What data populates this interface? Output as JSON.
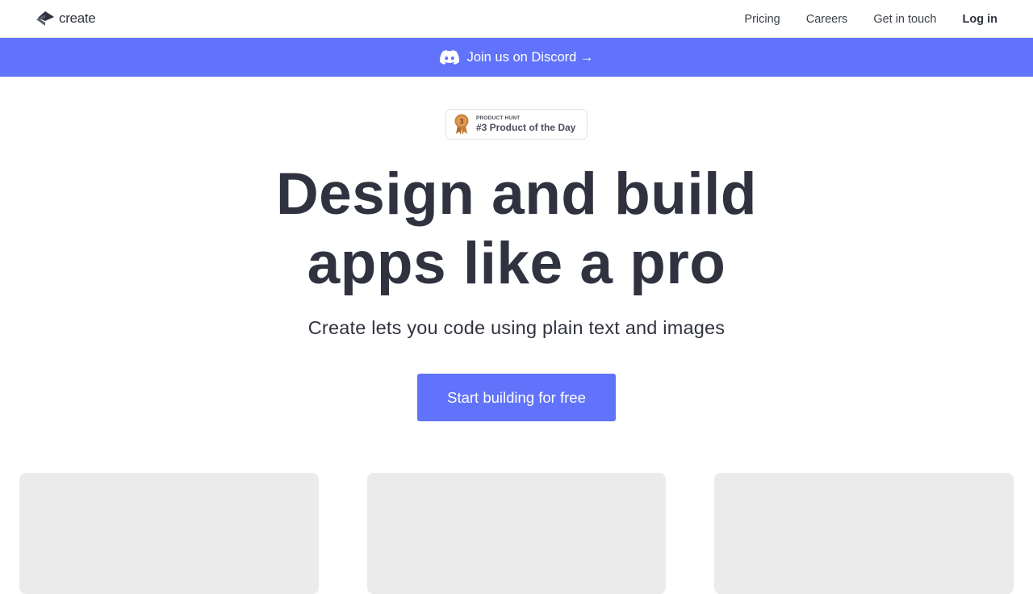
{
  "nav": {
    "brand": "create",
    "links": [
      {
        "label": "Pricing"
      },
      {
        "label": "Careers"
      },
      {
        "label": "Get in touch"
      }
    ],
    "login": "Log in"
  },
  "banner": {
    "text": "Join us on Discord →",
    "icon": "discord-icon",
    "color": "#6173fa"
  },
  "badge": {
    "kicker": "PRODUCT HUNT",
    "title": "#3 Product of the Day",
    "medal_number": "3"
  },
  "hero": {
    "title_line1": "Design and build",
    "title_line2": "apps like a pro",
    "subtitle": "Create lets you code using plain text and images",
    "cta": "Start building for free"
  },
  "colors": {
    "accent": "#6173fa",
    "text": "#30333f",
    "card": "#ebebeb"
  }
}
